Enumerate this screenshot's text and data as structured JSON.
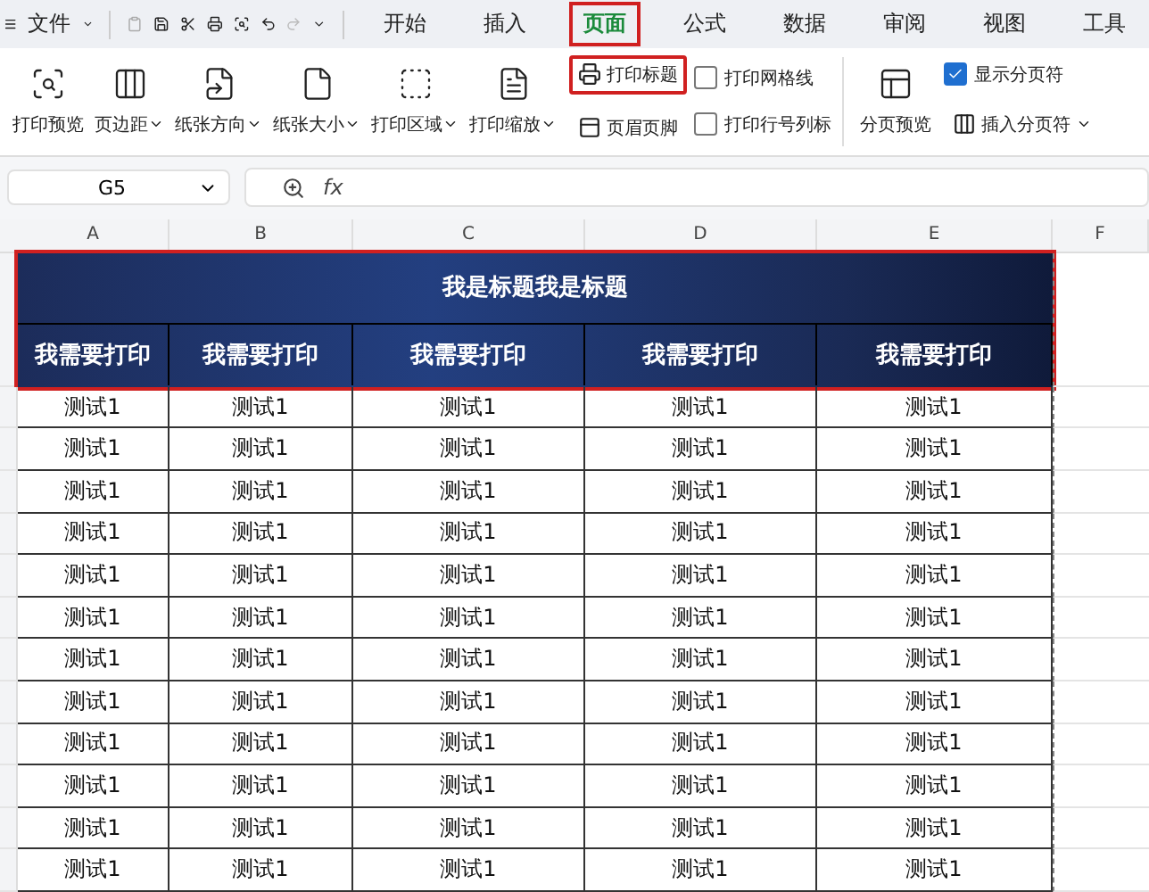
{
  "menu": {
    "file": "文件",
    "tabs": [
      {
        "label": "开始",
        "selected": false
      },
      {
        "label": "插入",
        "selected": false
      },
      {
        "label": "页面",
        "selected": true
      },
      {
        "label": "公式",
        "selected": false
      },
      {
        "label": "数据",
        "selected": false
      },
      {
        "label": "审阅",
        "selected": false
      },
      {
        "label": "视图",
        "selected": false
      },
      {
        "label": "工具",
        "selected": false
      }
    ]
  },
  "ribbon": {
    "big": [
      {
        "label": "打印预览",
        "dropdown": false
      },
      {
        "label": "页边距",
        "dropdown": true
      },
      {
        "label": "纸张方向",
        "dropdown": true
      },
      {
        "label": "纸张大小",
        "dropdown": true
      },
      {
        "label": "打印区域",
        "dropdown": true
      },
      {
        "label": "打印缩放",
        "dropdown": true
      }
    ],
    "small": [
      {
        "label": "打印标题",
        "highlighted": true
      },
      {
        "label": "页眉页脚",
        "highlighted": false
      }
    ],
    "checks": [
      {
        "label": "打印网格线",
        "checked": false
      },
      {
        "label": "打印行号列标",
        "checked": false
      }
    ],
    "page_break_preview": "分页预览",
    "show_breaks": {
      "label": "显示分页符",
      "checked": true
    },
    "insert_break": "插入分页符"
  },
  "formula_bar": {
    "cell": "G5",
    "fx": "fx"
  },
  "columns": [
    "A",
    "B",
    "C",
    "D",
    "E",
    "F"
  ],
  "sheet": {
    "title": "我是标题我是标题",
    "headers": [
      "我需要打印",
      "我需要打印",
      "我需要打印",
      "我需要打印",
      "我需要打印"
    ],
    "rows": [
      [
        "测试1",
        "测试1",
        "测试1",
        "测试1",
        "测试1"
      ],
      [
        "测试1",
        "测试1",
        "测试1",
        "测试1",
        "测试1"
      ],
      [
        "测试1",
        "测试1",
        "测试1",
        "测试1",
        "测试1"
      ],
      [
        "测试1",
        "测试1",
        "测试1",
        "测试1",
        "测试1"
      ],
      [
        "测试1",
        "测试1",
        "测试1",
        "测试1",
        "测试1"
      ],
      [
        "测试1",
        "测试1",
        "测试1",
        "测试1",
        "测试1"
      ],
      [
        "测试1",
        "测试1",
        "测试1",
        "测试1",
        "测试1"
      ],
      [
        "测试1",
        "测试1",
        "测试1",
        "测试1",
        "测试1"
      ],
      [
        "测试1",
        "测试1",
        "测试1",
        "测试1",
        "测试1"
      ],
      [
        "测试1",
        "测试1",
        "测试1",
        "测试1",
        "测试1"
      ],
      [
        "测试1",
        "测试1",
        "测试1",
        "测试1",
        "测试1"
      ],
      [
        "测试1",
        "测试1",
        "测试1",
        "测试1",
        "测试1"
      ]
    ]
  }
}
